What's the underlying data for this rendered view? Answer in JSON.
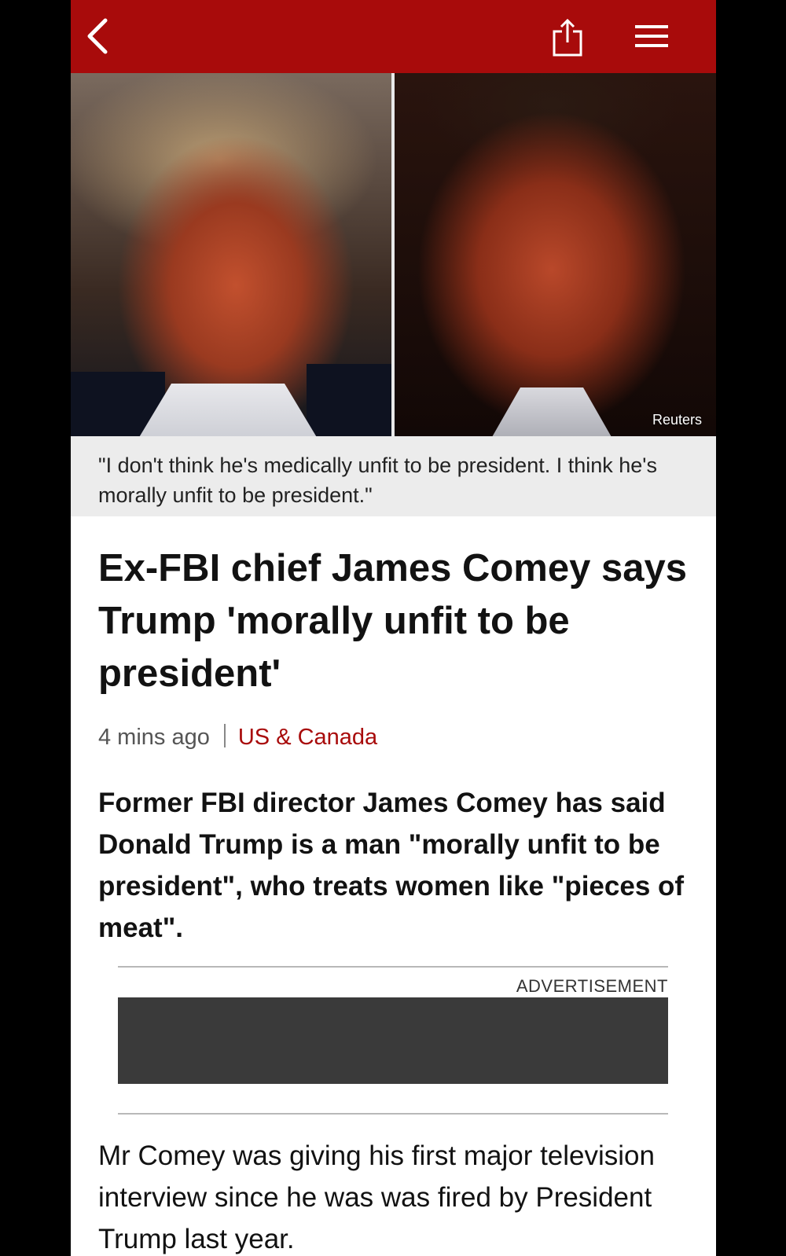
{
  "topbar": {
    "color": "#a80b0b",
    "back_icon": "chevron-left-icon",
    "share_icon": "share-icon",
    "menu_icon": "hamburger-menu-icon"
  },
  "hero": {
    "credit": "Reuters"
  },
  "caption": {
    "text": "\"I don't think he's medically unfit to be president. I think he's morally unfit to be president.\""
  },
  "article": {
    "headline": "Ex-FBI chief James Comey says Trump 'morally unfit to be president'",
    "timestamp": "4 mins ago",
    "section": "US & Canada",
    "section_color": "#a80b0b",
    "summary": "Former FBI director James Comey has said Donald Trump is a man \"morally unfit to be president\", who treats women like \"pieces of meat\".",
    "body": "Mr Comey was giving his first major television interview since he was was fired by President Trump last year."
  },
  "advertisement": {
    "label": "ADVERTISEMENT"
  }
}
